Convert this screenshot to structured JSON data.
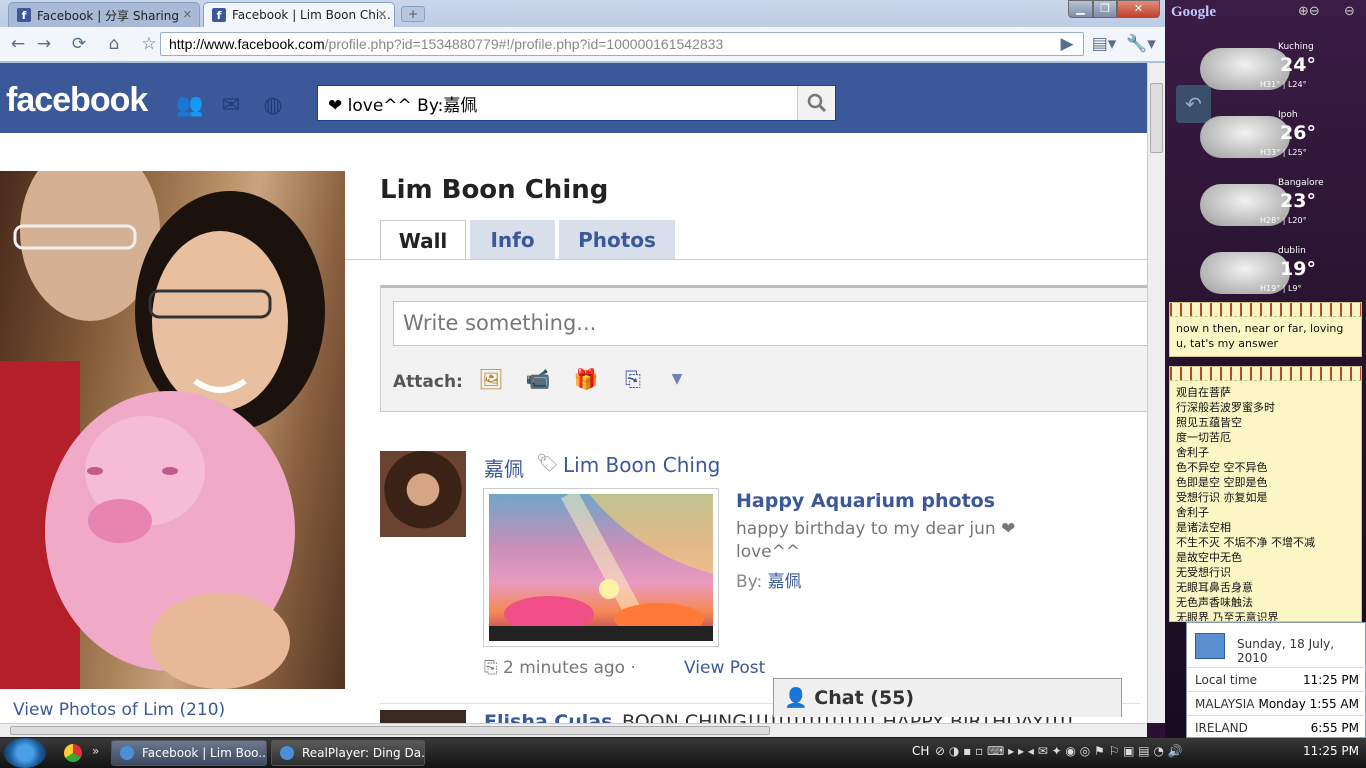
{
  "browser": {
    "tabs": [
      {
        "title": "Facebook | 分享 Sharing"
      },
      {
        "title": "Facebook | Lim Boon Chi..."
      }
    ],
    "url_domain": "http://www.facebook.com",
    "url_rest": "/profile.php?id=1534880779#!/profile.php?id=100000161542833"
  },
  "facebook": {
    "logo": "facebook",
    "search_value": "❤ love^^ By:嘉佩",
    "profile_name": "Lim Boon Ching",
    "view_photos": "View Photos of Lim (210)",
    "profile_tabs": [
      "Wall",
      "Info",
      "Photos"
    ],
    "composer_placeholder": "Write something...",
    "attach_label": "Attach:",
    "story": {
      "author": "嘉佩",
      "target": "Lim Boon Ching",
      "app_title": "Happy Aquarium photos",
      "message": "happy birthday to my dear jun ❤ love^^",
      "by_label": "By:",
      "by_name": "嘉佩",
      "time": "2 minutes ago",
      "separator": "·",
      "view_post": "View Post"
    },
    "next_story": {
      "name": "Elisha Culas",
      "text": "BOON CHING!!!!!!!!!!!!!!!!! HAPPY BIRTHDAY!!!!"
    },
    "chat": "Chat (55)"
  },
  "sidebar": {
    "google": "Google",
    "weather": [
      {
        "city": "Kuching",
        "temp": "24°",
        "hl": "H31° | L24°"
      },
      {
        "city": "Ipoh",
        "temp": "26°",
        "hl": "H33° | L25°"
      },
      {
        "city": "Bangalore",
        "temp": "23°",
        "hl": "H28° | L20°"
      },
      {
        "city": "dublin",
        "temp": "19°",
        "hl": "H19° | L9°"
      }
    ],
    "note1": "now n then, near or far, loving u, tat's my answer",
    "note2_lines": [
      "观自在菩萨",
      "行深般若波罗蜜多时",
      "照见五蕴皆空",
      "度一切苦厄",
      "舍利子",
      "色不异空 空不异色",
      "色即是空 空即是色",
      "受想行识 亦复如是",
      "舍利子",
      "是诸法空相",
      "不生不灭 不垢不净 不增不减",
      "是故空中无色",
      "无受想行识",
      "无眼耳鼻舌身意",
      "无色声香味触法",
      "无眼界 乃至无意识界"
    ]
  },
  "clock": {
    "date": "Sunday, 18 July, 2010",
    "rows": [
      {
        "label": "Local time",
        "value": "11:25 PM"
      },
      {
        "label": "MALAYSIA",
        "value": "Monday 1:55 AM"
      },
      {
        "label": "IRELAND",
        "value": "6:55 PM"
      }
    ]
  },
  "taskbar": {
    "items": [
      "Facebook | Lim Boo...",
      "RealPlayer: Ding Da..."
    ],
    "lang": "CH",
    "time": "11:25 PM"
  }
}
